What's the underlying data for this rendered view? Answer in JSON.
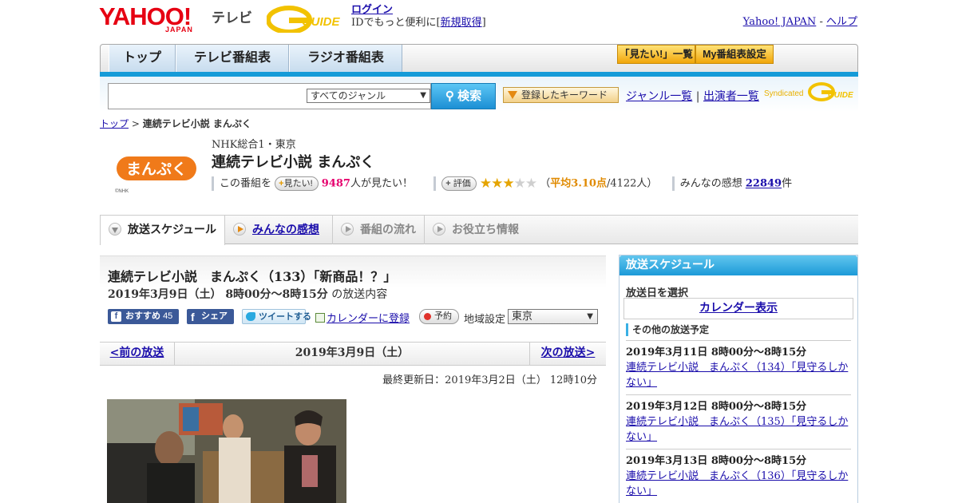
{
  "header": {
    "logo": "YAHOO!",
    "logo_sub": "JAPAN",
    "tv": "テレビ",
    "gguide": "G-GUIDE",
    "login": "ログイン",
    "login_pre": "IDでもっと便利に[",
    "register": "新規取得",
    "login_post": "]",
    "yahoo_japan": "Yahoo! JAPAN",
    "sep": "-",
    "help": "ヘルプ"
  },
  "nav": {
    "tabs": [
      "トップ",
      "テレビ番組表",
      "ラジオ番組表"
    ],
    "mitai_list": "「見たい!」一覧",
    "my_settings": "My番組表設定"
  },
  "search": {
    "placeholder": "",
    "genre": "すべてのジャンル",
    "button": "検索",
    "keyword_btn": "登録したキーワード",
    "genre_list": "ジャンル一覧",
    "divider": "|",
    "cast_list": "出演者一覧",
    "syndicated": "Syndicated"
  },
  "breadcrumb": {
    "home": "トップ",
    "sep": ">",
    "current": "連続テレビ小説 まんぷく"
  },
  "program": {
    "logo_text": "まんぷく",
    "logo_credit": "©NHK",
    "station": "NHK総合1・東京",
    "title": "連続テレビ小説 まんぷく",
    "want_pre": "この番組を",
    "want_btn": "見たい!",
    "want_count": "9487",
    "want_post": "人が見たい！",
    "rate_btn": "評価",
    "rating": 3.1,
    "rating_open": "（",
    "rating_avg": "平均3.10点",
    "rating_people": "/4122人）",
    "impressions_label": "みんなの感想",
    "impressions_count": "22849",
    "impressions_unit": "件"
  },
  "subtabs": [
    "放送スケジュール",
    "みんなの感想",
    "番組の流れ",
    "お役立ち情報"
  ],
  "episode": {
    "title": "連続テレビ小説　まんぷく（133）「新商品！？」",
    "time": "2019年3月9日（土） 8時00分～8時15分",
    "time_suffix": "の放送内容",
    "fb_recommend": "おすすめ",
    "fb_count": "45",
    "fb_share": "シェア",
    "tweet": "ツイートする",
    "calendar": "カレンダーに登録",
    "reserve": "予約",
    "region_label": "地域設定",
    "region": "東京"
  },
  "pager": {
    "prev": "<前の放送",
    "date": "2019年3月9日（土）",
    "next": "次の放送>"
  },
  "updated": "最終更新日：2019年3月2日（土） 12時10分",
  "sidebar": {
    "title": "放送スケジュール",
    "select_date": "放送日を選択",
    "calendar": "カレンダー表示",
    "other": "その他の放送予定",
    "items": [
      {
        "time": "2019年3月11日  8時00分～8時15分",
        "title": "連続テレビ小説　まんぷく（134）「見守るしかない」"
      },
      {
        "time": "2019年3月12日  8時00分～8時15分",
        "title": "連続テレビ小説　まんぷく（135）「見守るしかない」"
      },
      {
        "time": "2019年3月13日  8時00分～8時15分",
        "title": "連続テレビ小説　まんぷく（136）「見守るしかない」"
      }
    ]
  },
  "colors": {
    "yahoo_red": "#e60012",
    "brand_blue": "#159bd8",
    "gguide_yellow": "#f2c200",
    "link": "#1a0dab",
    "want_pink": "#e6006e",
    "star": "#e5a400"
  }
}
